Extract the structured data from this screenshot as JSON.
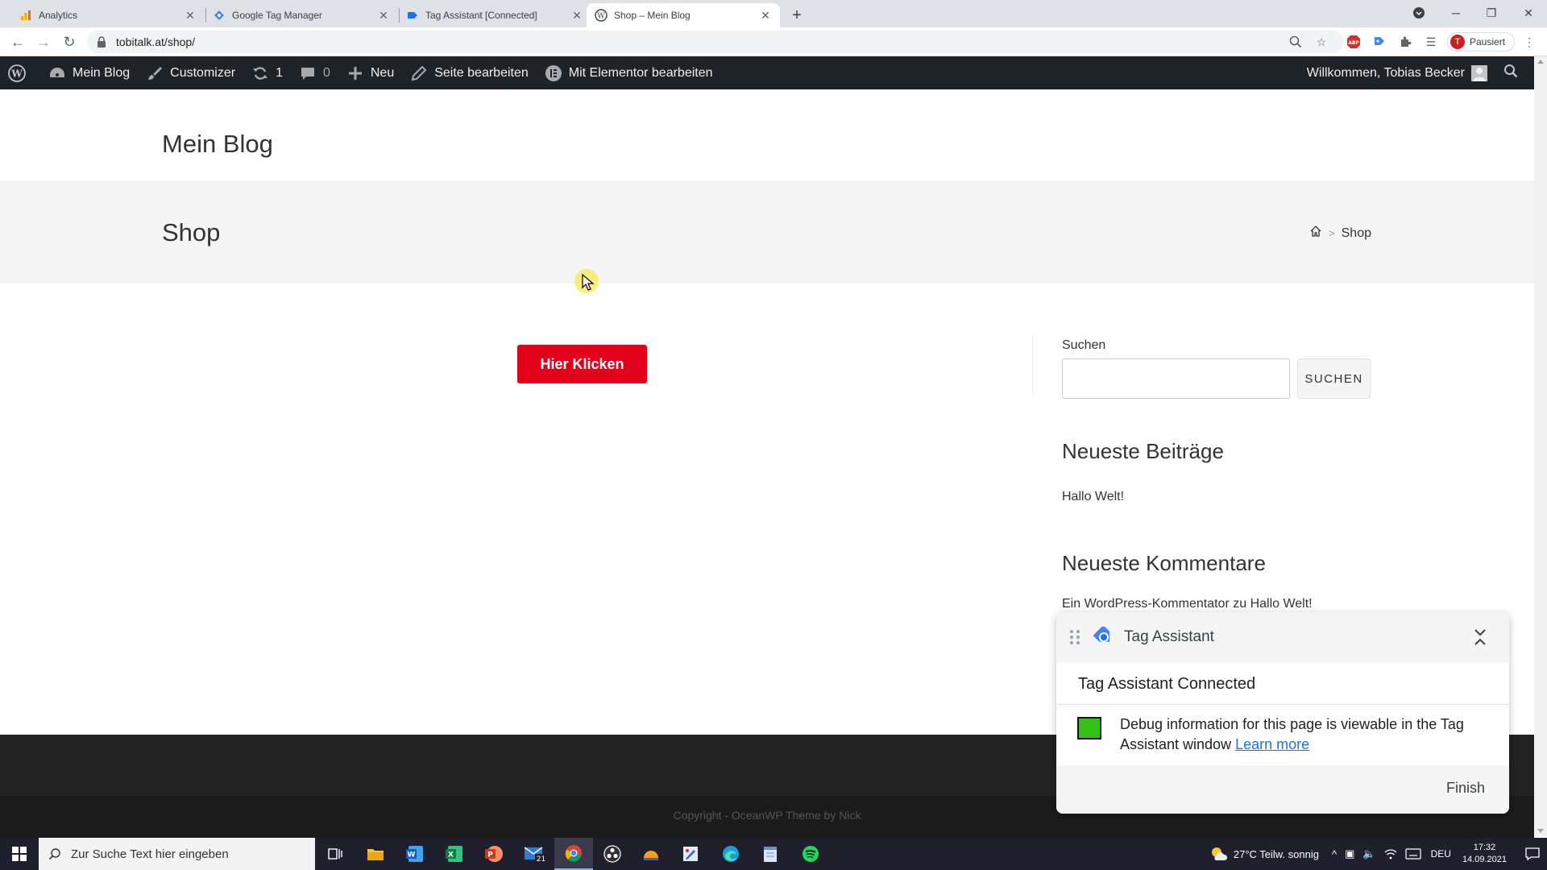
{
  "browser": {
    "tabs": [
      {
        "title": "Analytics",
        "icon": "analytics-icon"
      },
      {
        "title": "Google Tag Manager",
        "icon": "gtm-icon"
      },
      {
        "title": "Tag Assistant [Connected]",
        "icon": "tag-icon"
      },
      {
        "title": "Shop – Mein Blog",
        "icon": "wordpress-icon",
        "active": true
      }
    ],
    "url": "tobitalk.at/shop/",
    "profile_label": "Pausiert",
    "profile_initial": "T"
  },
  "adminbar": {
    "site": "Mein Blog",
    "customizer": "Customizer",
    "updates": "1",
    "comments": "0",
    "new": "Neu",
    "edit_page": "Seite bearbeiten",
    "elementor": "Mit Elementor bearbeiten",
    "welcome": "Willkommen, Tobias Becker"
  },
  "site": {
    "title": "Mein Blog",
    "page_title": "Shop",
    "breadcrumb_sep": ">",
    "breadcrumb_current": "Shop"
  },
  "main": {
    "cta_label": "Hier Klicken"
  },
  "sidebar": {
    "search_label": "Suchen",
    "search_button": "SUCHEN",
    "recent_posts_heading": "Neueste Beiträge",
    "recent_post": "Hallo Welt!",
    "recent_comments_heading": "Neueste Kommentare",
    "recent_comment": "Ein WordPress-Kommentator zu Hallo Welt!"
  },
  "footer": {
    "copyright": "Copyright - OceanWP Theme by Nick"
  },
  "tag_assistant": {
    "title": "Tag Assistant",
    "status": "Tag Assistant Connected",
    "message": "Debug information for this page is viewable in the Tag Assistant window",
    "learn_more": "Learn more",
    "finish": "Finish",
    "status_color": "#34c219"
  },
  "taskbar": {
    "search_placeholder": "Zur Suche Text hier eingeben",
    "mail_badge": "21",
    "weather": "27°C  Teilw. sonnig",
    "language": "DEU",
    "time": "17:32",
    "date": "14.09.2021"
  },
  "colors": {
    "cta": "#e3001b",
    "adminbar": "#1d2327",
    "link": "#1a73e8"
  }
}
